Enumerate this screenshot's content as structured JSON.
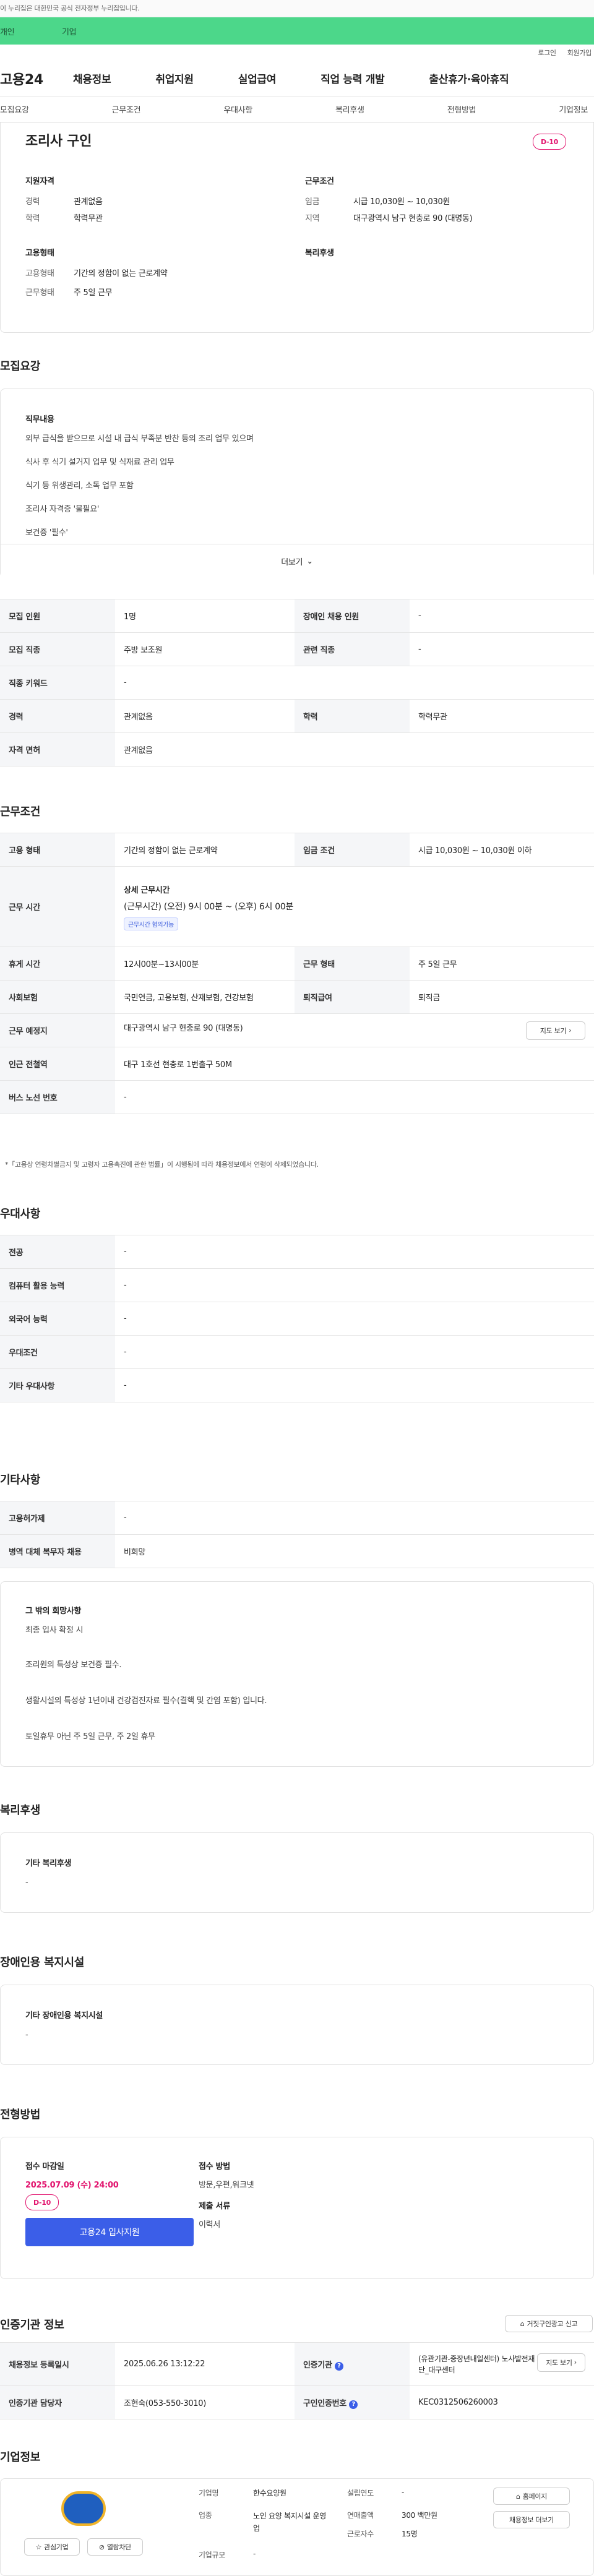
{
  "topbar": {
    "notice": "이 누리집은 대한민국 공식 전자정부 누리집입니다."
  },
  "mode": {
    "individual": "개인",
    "company": "기업"
  },
  "util": {
    "login": "로그인",
    "join": "회원가입"
  },
  "gnb": {
    "logo": "고용24",
    "items": [
      "채용정보",
      "취업지원",
      "실업급여",
      "직업 능력 개발",
      "출산휴가·육아휴직"
    ]
  },
  "subtabs": [
    "모집요강",
    "근무조건",
    "우대사항",
    "복리후생",
    "전형방법",
    "기업정보"
  ],
  "summary": {
    "title": "조리사 구인",
    "dday": "D-10",
    "qual_title": "지원자격",
    "career_k": "경력",
    "career_v": "관계없음",
    "edu_k": "학력",
    "edu_v": "학력무관",
    "emp_title": "고용형태",
    "emptype_k": "고용형태",
    "emptype_v": "기간의 정함이 없는 근로계약",
    "workform_k": "근무형태",
    "workform_v": "주 5일 근무",
    "cond_title": "근무조건",
    "wage_k": "임금",
    "wage_v": "시급 10,030원 ~ 10,030원",
    "area_k": "지역",
    "area_v": "대구광역시 남구 현충로 90 (대명동)",
    "welfare_title": "복리후생"
  },
  "recruit": {
    "heading": "모집요강",
    "duty_title": "직무내용",
    "duties": [
      "외부 급식을 받으므로 시설 내 급식 부족분 반찬 등의 조리 업무 있으며",
      "식사 후 식기 설거지 업무 및 식재료 관리 업무",
      "식기 등 위생관리, 소독 업무 포함",
      "조리사 자격증 '불필요'",
      "보건증 '필수'"
    ],
    "more": "더보기",
    "rows": [
      [
        "모집 인원",
        "1명",
        "장애인 채용 인원",
        "-"
      ],
      [
        "모집 직종",
        "주방 보조원",
        "관련 직종",
        "-"
      ],
      [
        "직종 키워드",
        "-"
      ],
      [
        "경력",
        "관계없음",
        "학력",
        "학력무관"
      ],
      [
        "자격 면허",
        "관계없음"
      ]
    ]
  },
  "work": {
    "heading": "근무조건",
    "r1": [
      "고용 형태",
      "기간의 정함이 없는 근로계약",
      "임금 조건",
      "시급 10,030원 ~ 10,030원 이하"
    ],
    "hours_k": "근무 시간",
    "hours_title": "상세 근무시간",
    "hours_v": "(근무시간) (오전) 9시 00분 ~ (오후) 6시 00분",
    "hours_tag": "근무시간 협의가능",
    "r3": [
      "휴게 시간",
      "12시00분~13시00분",
      "근무 형태",
      "주 5일 근무"
    ],
    "r4": [
      "사회보험",
      "국민연금, 고용보험, 산재보험, 건강보험",
      "퇴직급여",
      "퇴직금"
    ],
    "loc_k": "근무 예정지",
    "loc_v": "대구광역시 남구 현충로 90 (대명동)",
    "map_btn": "지도 보기",
    "subway_k": "인근 전철역",
    "subway_v": "대구 1호선 현충로 1번출구 50M",
    "bus_k": "버스 노선 번호",
    "bus_v": "-",
    "note": "*「고용상 연령차별금지 및 고령자 고용촉진에 관한 법률」이 시행됨에 따라 채용정보에서 연령이 삭제되었습니다."
  },
  "pref": {
    "heading": "우대사항",
    "rows": [
      [
        "전공",
        "-"
      ],
      [
        "컴퓨터 활용 능력",
        "-"
      ],
      [
        "외국어 능력",
        "-"
      ],
      [
        "우대조건",
        "-"
      ],
      [
        "기타 우대사항",
        "-"
      ]
    ]
  },
  "etc": {
    "heading": "기타사항",
    "rows": [
      [
        "고용허가제",
        "-"
      ],
      [
        "병역 대체 복무자 채용",
        "비희망"
      ]
    ],
    "hope_title": "그 밖의 희망사항",
    "hope": [
      "최종 입사 확정 시",
      "조리원의 특성상 보건증 필수.",
      "생활시설의 특성상 1년이내 건강검진자료 필수(결핵 및 간염 포함) 입니다.",
      "토일휴무 아닌 주 5일 근무, 주 2일 휴무"
    ]
  },
  "welfare": {
    "heading": "복리후생",
    "title": "기타 복리후생",
    "value": "-"
  },
  "disab": {
    "heading": "장애인용 복지시설",
    "title": "기타 장애인용 복지시설",
    "value": "-"
  },
  "select": {
    "heading": "전형방법",
    "deadline_k": "접수 마감일",
    "deadline_v": "2025.07.09 (수) 24:00",
    "dday": "D-10",
    "apply": "고용24 입사지원",
    "method_k": "접수 방법",
    "method_v": "방문,우편,워크넷",
    "docs_k": "제출 서류",
    "docs_v": "이력서"
  },
  "cert": {
    "heading": "인증기관 정보",
    "report": "거짓구인광고 신고",
    "reg_k": "채용정보 등록일시",
    "reg_v": "2025.06.26 13:12:22",
    "org_k": "인증기관",
    "org_v": "(유관기관-중장년내일센터) 노사발전재단_대구센터",
    "map_btn": "지도 보기",
    "mgr_k": "인증기관 담당자",
    "mgr_v": "조현숙(053-550-3010)",
    "no_k": "구인인증번호",
    "no_v": "KEC0312506260003"
  },
  "company": {
    "heading": "기업정보",
    "fav": "관심기업",
    "pin": "열람차단",
    "homepage": "홈페이지",
    "jobs": "채용정보 더보기",
    "ind_k": "기업명",
    "ind_v": "한수요양원",
    "biz_k": "업종",
    "biz_v": "노인 요양 복지시설 운영업",
    "size_k": "기업규모",
    "size_v": "-",
    "est_k": "설립연도",
    "est_v": "-",
    "sales_k": "연매출액",
    "sales_v": "300 백만원",
    "emp_k": "근로자수",
    "emp_v": "15명"
  }
}
